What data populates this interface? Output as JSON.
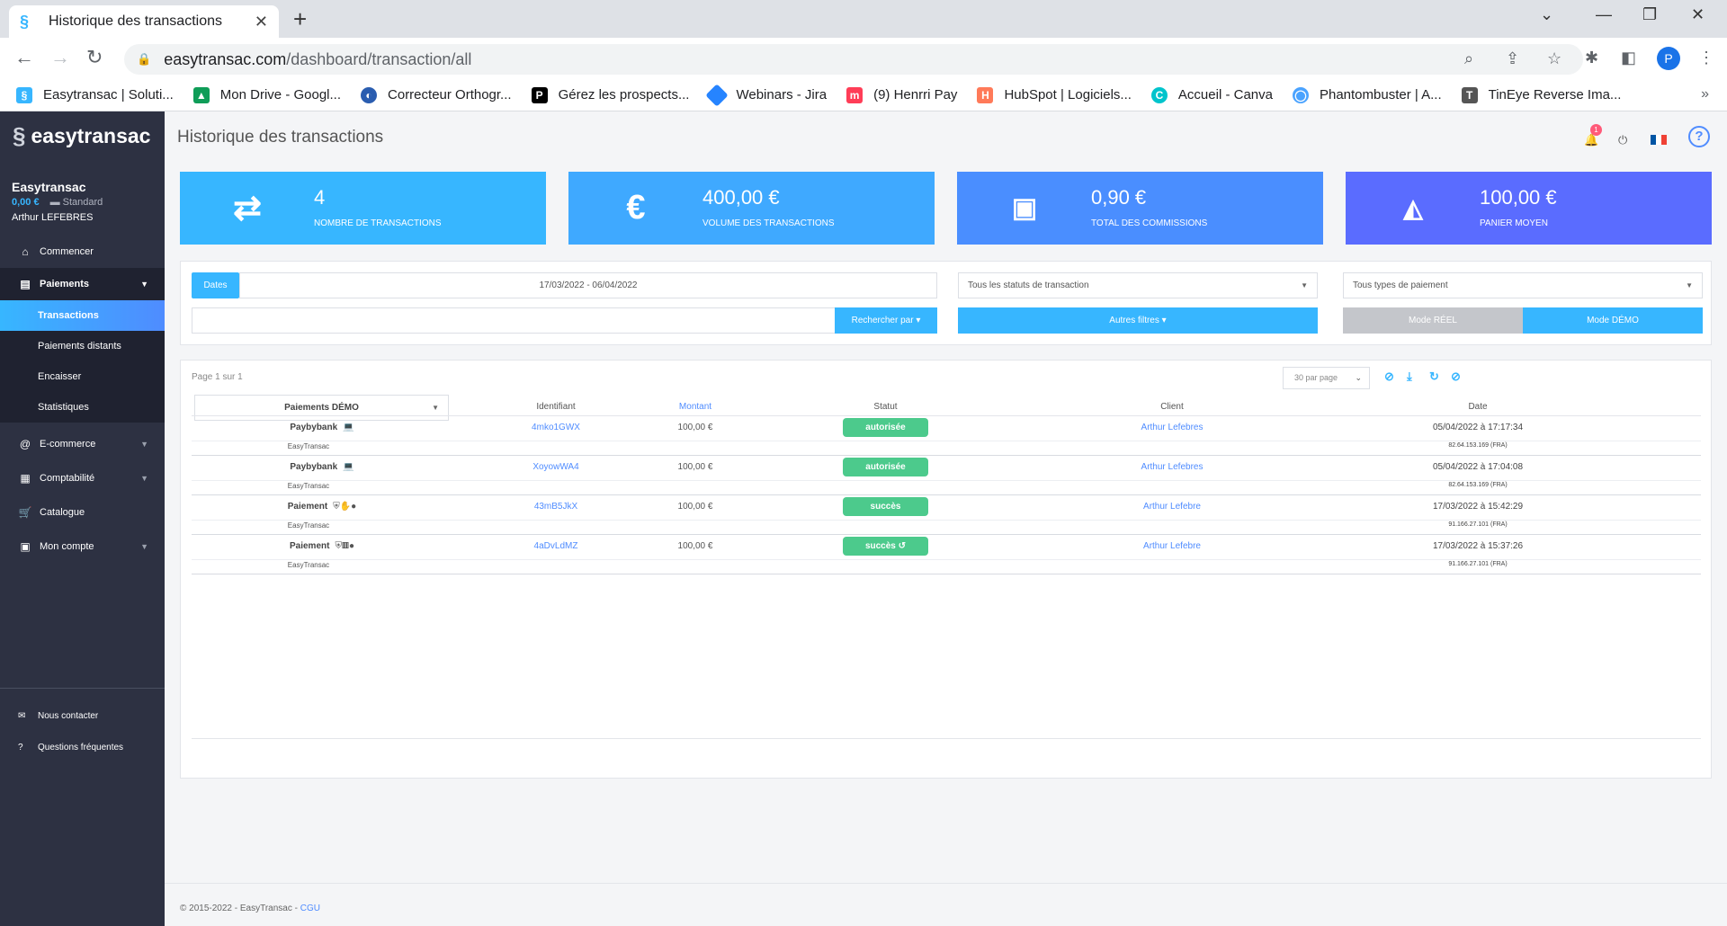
{
  "browser": {
    "tab_title": "Historique des transactions",
    "url_host": "easytransac.com",
    "url_path": "/dashboard/transaction/all",
    "avatar_letter": "P",
    "bookmarks": [
      {
        "label": "Easytransac | Soluti...",
        "color": "#37b6ff"
      },
      {
        "label": "Mon Drive - Googl...",
        "color": "#0f9d58"
      },
      {
        "label": "Correcteur Orthogr...",
        "color": "#2a5db0"
      },
      {
        "label": "Gérez les prospects...",
        "color": "#000000"
      },
      {
        "label": "Webinars - Jira",
        "color": "#2684ff"
      },
      {
        "label": "(9) Henrri Pay",
        "color": "#ff3d57"
      },
      {
        "label": "HubSpot | Logiciels...",
        "color": "#ff7a59"
      },
      {
        "label": "Accueil - Canva",
        "color": "#00c4cc"
      },
      {
        "label": "Phantombuster | A...",
        "color": "#4aa3ff"
      },
      {
        "label": "TinEye Reverse Ima...",
        "color": "#555555"
      }
    ]
  },
  "sidebar": {
    "brand": "easytransac",
    "account_name": "Easytransac",
    "balance": "0,00 €",
    "plan": "Standard",
    "user": "Arthur LEFEBRES",
    "items": [
      {
        "label": "Commencer",
        "icon": "home-icon"
      },
      {
        "label": "Paiements",
        "icon": "card-icon"
      },
      {
        "label": "E-commerce",
        "icon": "at-icon"
      },
      {
        "label": "Comptabilité",
        "icon": "calculator-icon"
      },
      {
        "label": "Catalogue",
        "icon": "cart-icon"
      },
      {
        "label": "Mon compte",
        "icon": "id-card-icon"
      }
    ],
    "sub_items": [
      "Transactions",
      "Paiements distants",
      "Encaisser",
      "Statistiques"
    ],
    "contact": "Nous contacter",
    "faq": "Questions fréquentes"
  },
  "header": {
    "title": "Historique des transactions",
    "notif_count": "1"
  },
  "kpis": [
    {
      "value": "4",
      "label": "NOMBRE DE TRANSACTIONS",
      "icon": "exchange-icon",
      "color": "#37b6ff"
    },
    {
      "value": "400,00 €",
      "label": "VOLUME DES TRANSACTIONS",
      "icon": "euro-icon",
      "color": "#3fa9ff"
    },
    {
      "value": "0,90 €",
      "label": "TOTAL DES COMMISSIONS",
      "icon": "banknote-icon",
      "color": "#4a8eff"
    },
    {
      "value": "100,00 €",
      "label": "PANIER MOYEN",
      "icon": "area-chart-icon",
      "color": "#5a6cff"
    }
  ],
  "filters": {
    "dates_label": "Dates",
    "date_range": "17/03/2022 - 06/04/2022",
    "status_select": "Tous les statuts de transaction",
    "payment_type_select": "Tous types de paiement",
    "search_button": "Rechercher par",
    "more_filters": "Autres filtres",
    "mode_real": "Mode RÉEL",
    "mode_demo": "Mode DÉMO"
  },
  "table": {
    "page_info": "Page 1 sur 1",
    "per_page": "30 par page",
    "type_select": "Paiements DÉMO",
    "columns": {
      "id": "Identifiant",
      "amount": "Montant",
      "status": "Statut",
      "client": "Client",
      "date": "Date"
    },
    "rows": [
      {
        "type": "Paybybank",
        "type_icons": "💻",
        "merchant": "EasyTransac",
        "id": "4mko1GWX",
        "amount": "100,00 €",
        "status": "autorisée",
        "client": "Arthur Lefebres",
        "date": "05/04/2022 à 17:17:34",
        "ip": "82.64.153.169 (FRA)"
      },
      {
        "type": "Paybybank",
        "type_icons": "💻",
        "merchant": "EasyTransac",
        "id": "XoyowWA4",
        "amount": "100,00 €",
        "status": "autorisée",
        "client": "Arthur Lefebres",
        "date": "05/04/2022 à 17:04:08",
        "ip": "82.64.153.169 (FRA)"
      },
      {
        "type": "Paiement",
        "type_icons": "⛨✋●",
        "merchant": "EasyTransac",
        "id": "43mB5JkX",
        "amount": "100,00 €",
        "status": "succès",
        "client": "Arthur Lefebre",
        "date": "17/03/2022 à 15:42:29",
        "ip": "91.166.27.101 (FRA)"
      },
      {
        "type": "Paiement",
        "type_icons": "⛨▥●",
        "merchant": "EasyTransac",
        "id": "4aDvLdMZ",
        "amount": "100,00 €",
        "status": "succès ↺",
        "client": "Arthur Lefebre",
        "date": "17/03/2022 à 15:37:26",
        "ip": "91.166.27.101 (FRA)"
      }
    ]
  },
  "footer": {
    "copyright": "© 2015-2022 - EasyTransac - ",
    "cgu": "CGU"
  }
}
